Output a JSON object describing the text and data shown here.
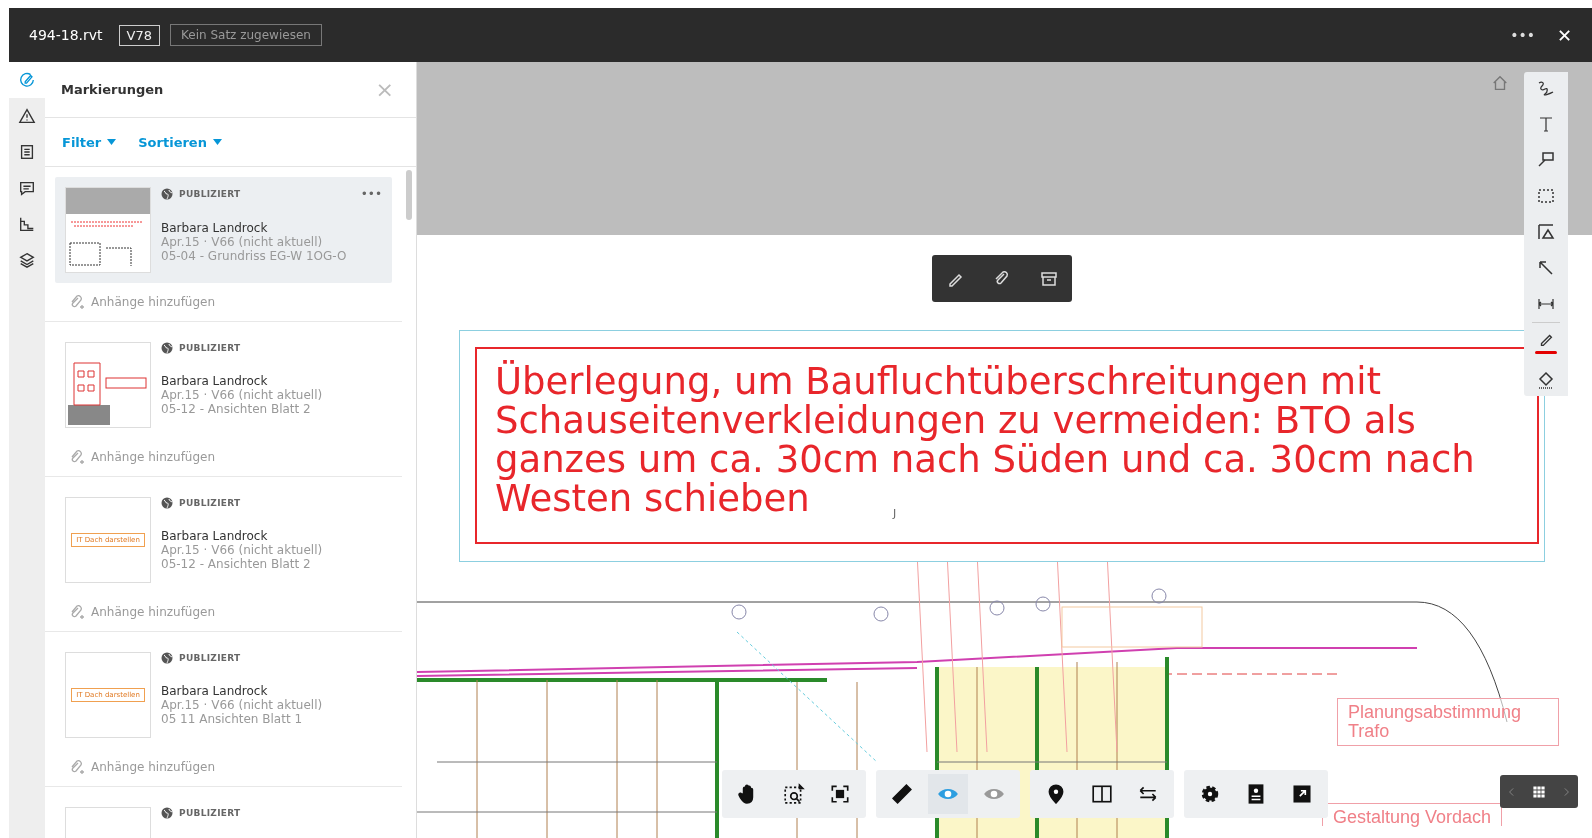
{
  "header": {
    "file_name": "494-18.rvt",
    "version": "V78",
    "set_status": "Kein Satz zugewiesen",
    "more": "•••",
    "close": "✕"
  },
  "rail": [
    {
      "selected": true
    },
    {
      "selected": false
    },
    {
      "selected": false
    },
    {
      "selected": false
    },
    {
      "selected": false
    },
    {
      "selected": false
    }
  ],
  "panel": {
    "title": "Markierungen",
    "close": "×",
    "filter": "Filter",
    "sort": "Sortieren",
    "markups": [
      {
        "kind": "plan",
        "status": "PUBLIZIERT",
        "author": "Barbara Landrock",
        "meta": "Apr.15 · V66 (nicht aktuell)",
        "sheet": "05-04 - Grundriss EG-W 1OG-O",
        "attachments": "Anhänge hinzufügen",
        "selected": true,
        "menu": "•••"
      },
      {
        "kind": "elevation",
        "status": "PUBLIZIERT",
        "author": "Barbara Landrock",
        "meta": "Apr.15 · V66 (nicht aktuell)",
        "sheet": "05-12 - Ansichten Blatt 2",
        "attachments": "Anhänge hinzufügen",
        "selected": false
      },
      {
        "kind": "label",
        "thumbnail_text": "IT Dach darstellen",
        "status": "PUBLIZIERT",
        "author": "Barbara Landrock",
        "meta": "Apr.15 · V66 (nicht aktuell)",
        "sheet": "05-12 - Ansichten Blatt 2",
        "attachments": "Anhänge hinzufügen",
        "selected": false
      },
      {
        "kind": "label",
        "thumbnail_text": "IT Dach darstellen",
        "status": "PUBLIZIERT",
        "author": "Barbara Landrock",
        "meta": "Apr.15 · V66 (nicht aktuell)",
        "sheet": "05 11   Ansichten Blatt 1",
        "attachments": "Anhänge hinzufügen",
        "selected": false
      },
      {
        "kind": "blank",
        "status": "PUBLIZIERT",
        "selected": false
      }
    ]
  },
  "canvas": {
    "annotation": "Überlegung, um Baufluchtüberschreitungen mit Schauseitenverkleidungen zu vermeiden: BTO als ganzes um ca. 30cm nach Süden und ca. 30cm nach Westen schieben",
    "markup_labels": [
      "Planungsabstimmung Trafo",
      "Gestaltung Vordach"
    ],
    "grid_labels": [
      "J"
    ]
  },
  "markup_tools": [
    {
      "kind": "freehand"
    },
    {
      "kind": "text"
    },
    {
      "kind": "callout"
    },
    {
      "kind": "cloud"
    },
    {
      "kind": "polygon"
    },
    {
      "kind": "arrow"
    },
    {
      "kind": "dimension"
    },
    {
      "kind": "pen",
      "color": "#e30000"
    },
    {
      "kind": "fill"
    }
  ],
  "view_tools": [
    [
      {
        "kind": "pan",
        "selected": false
      },
      {
        "kind": "zoom-window",
        "selected": false
      },
      {
        "kind": "fit",
        "selected": false
      }
    ],
    [
      {
        "kind": "measure",
        "selected": false
      },
      {
        "kind": "show-markups",
        "selected": true
      },
      {
        "kind": "hide-markups",
        "selected": false
      }
    ],
    [
      {
        "kind": "pin",
        "selected": false
      },
      {
        "kind": "split",
        "selected": false
      },
      {
        "kind": "compare",
        "selected": false
      }
    ],
    [
      {
        "kind": "settings",
        "selected": false
      },
      {
        "kind": "properties",
        "selected": false
      },
      {
        "kind": "fullscreen",
        "selected": false
      }
    ]
  ]
}
